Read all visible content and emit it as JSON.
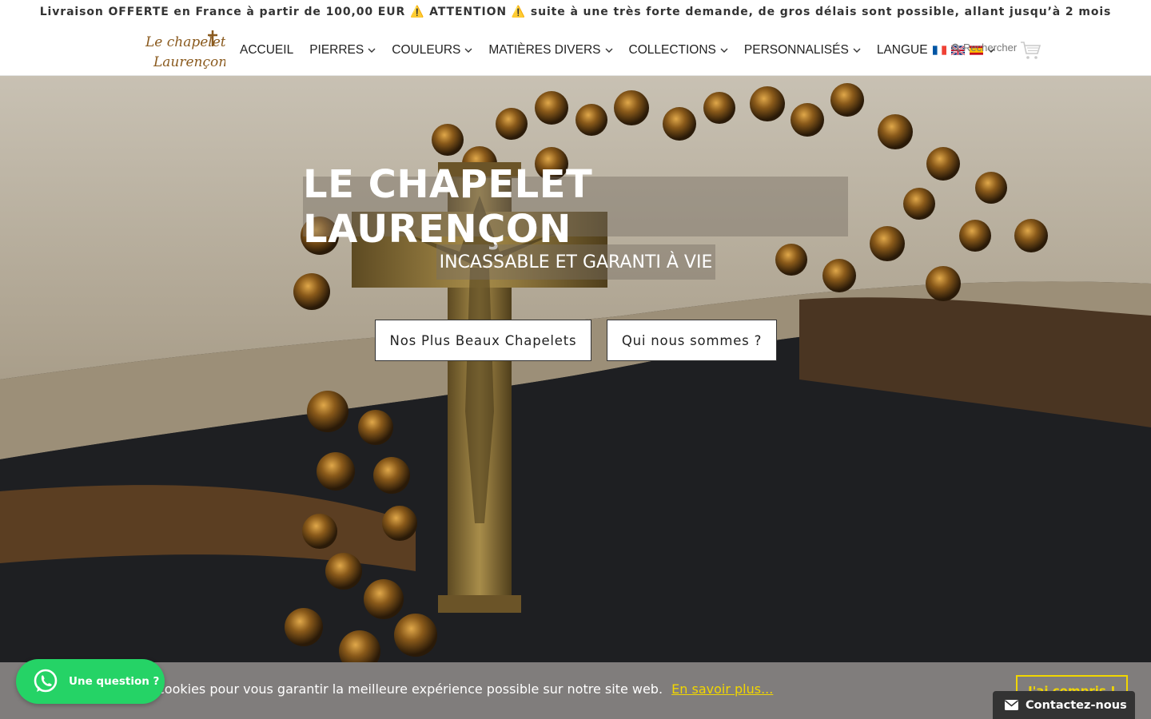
{
  "announcement": "Livraison OFFERTE en France à partir de 100,00 EUR ⚠️ ATTENTION ⚠️ suite à une très forte demande, de gros délais sont possible, allant jusqu’à 2 mois",
  "logo": {
    "text_line1": "Le chapelet",
    "text_line2": "Laurençon"
  },
  "nav": {
    "items": [
      {
        "label": "ACCUEIL",
        "dropdown": false
      },
      {
        "label": "PIERRES",
        "dropdown": true
      },
      {
        "label": "COULEURS",
        "dropdown": true
      },
      {
        "label": "MATIÈRES DIVERS",
        "dropdown": true
      },
      {
        "label": "COLLECTIONS",
        "dropdown": true
      },
      {
        "label": "PERSONNALISÉS",
        "dropdown": true
      },
      {
        "label": "LANGUE",
        "dropdown": true
      }
    ],
    "language_flags": [
      "flag-france-icon",
      "flag-uk-icon",
      "flag-spain-icon"
    ]
  },
  "search": {
    "label": "Rechercher",
    "icon": "search-icon"
  },
  "cart": {
    "icon": "cart-icon"
  },
  "hero": {
    "title": "LE CHAPELET LAURENÇON",
    "subtitle": "INCASSABLE ET GARANTI À VIE",
    "button_primary": "Nos Plus Beaux Chapelets",
    "button_secondary": "Qui nous sommes ?"
  },
  "cookie_bar": {
    "text": "cookies pour vous garantir la meilleure expérience possible sur notre site web.",
    "link": "En savoir plus...",
    "button": "J'ai compris !"
  },
  "whatsapp": {
    "label": "Une question ?",
    "icon": "whatsapp-icon"
  },
  "contact": {
    "label": "Contactez-nous",
    "icon": "envelope-icon"
  },
  "colors": {
    "accent_yellow": "#f1d600",
    "whatsapp_green": "#25d366",
    "cookie_bg": "#807d7c",
    "contact_bg": "#333333"
  }
}
